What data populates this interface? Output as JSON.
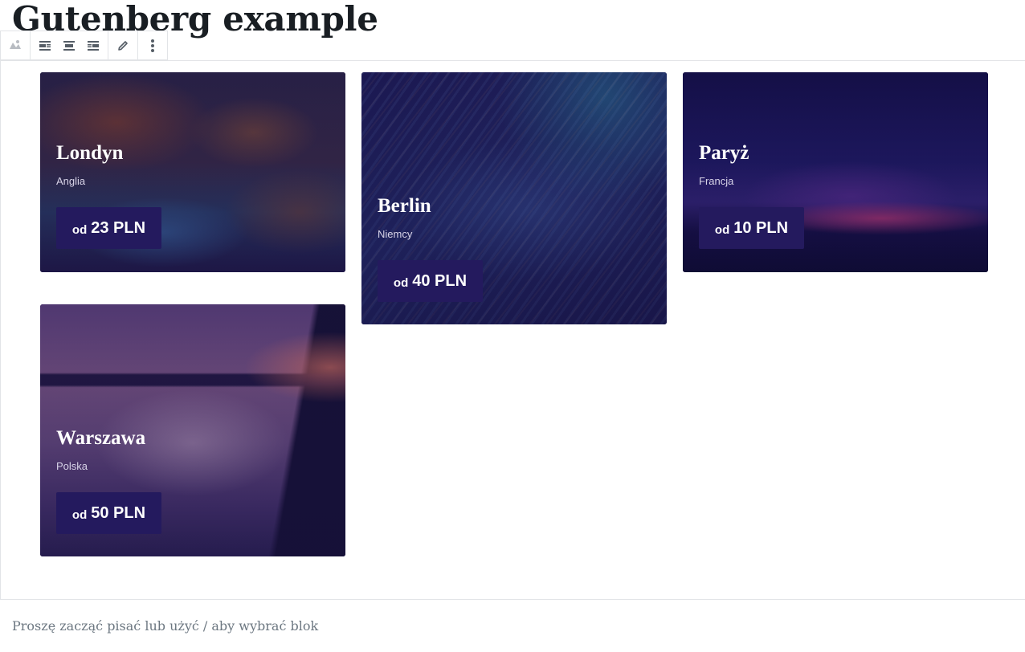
{
  "page": {
    "title": "Gutenberg example",
    "placeholder": "Proszę zacząć pisać lub użyć / aby wybrać blok"
  },
  "toolbar": {
    "icons": [
      "block-type-icon",
      "align-left-icon",
      "align-center-icon",
      "align-right-icon",
      "edit-pencil-icon",
      "more-options-icon"
    ]
  },
  "cards": [
    {
      "city": "Londyn",
      "country": "Anglia",
      "price_prefix": "od",
      "price": "23 PLN",
      "theme": "forest-river"
    },
    {
      "city": "Berlin",
      "country": "Niemcy",
      "price_prefix": "od",
      "price": "40 PLN",
      "theme": "glitter-streaks"
    },
    {
      "city": "Paryż",
      "country": "Francja",
      "price_prefix": "od",
      "price": "10 PLN",
      "theme": "night-horizon"
    },
    {
      "city": "Warszawa",
      "country": "Polska",
      "price_prefix": "od",
      "price": "50 PLN",
      "theme": "bridge-sunset"
    }
  ],
  "colors": {
    "price_button": "#241a5e",
    "card_overlay": "#1c1545",
    "city_text": "#ffffff",
    "country_text": "#d8d4e8"
  }
}
